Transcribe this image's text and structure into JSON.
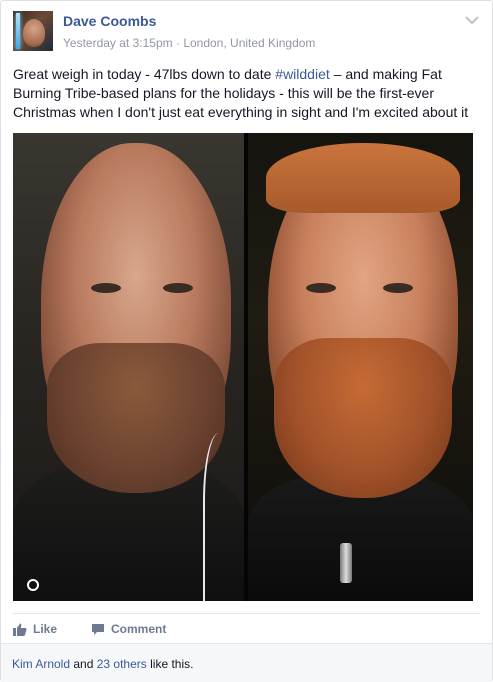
{
  "post": {
    "author": "Dave Coombs",
    "timestamp": "Yesterday at 3:15pm",
    "separator": " · ",
    "location": "London, United Kingdom",
    "text_before": "Great weigh in today - 47lbs down to date ",
    "hashtag": "#wilddiet",
    "text_after": " – and making Fat Burning Tribe-based plans for the holidays - this will be the first-ever Christmas when I don't just eat everything in sight and I'm excited about it",
    "options_icon": "chevron-down-icon"
  },
  "actions": {
    "like_label": "Like",
    "comment_label": "Comment",
    "like_icon": "thumbs-up-icon",
    "comment_icon": "speech-bubble-icon"
  },
  "likes": {
    "first_liker": "Kim Arnold",
    "and_text": " and ",
    "others_link": "23 others",
    "suffix": " like this."
  },
  "colors": {
    "link": "#3b5998",
    "meta": "#9197a3",
    "action": "#6d7a91",
    "likes_bg": "#f6f7f9"
  }
}
